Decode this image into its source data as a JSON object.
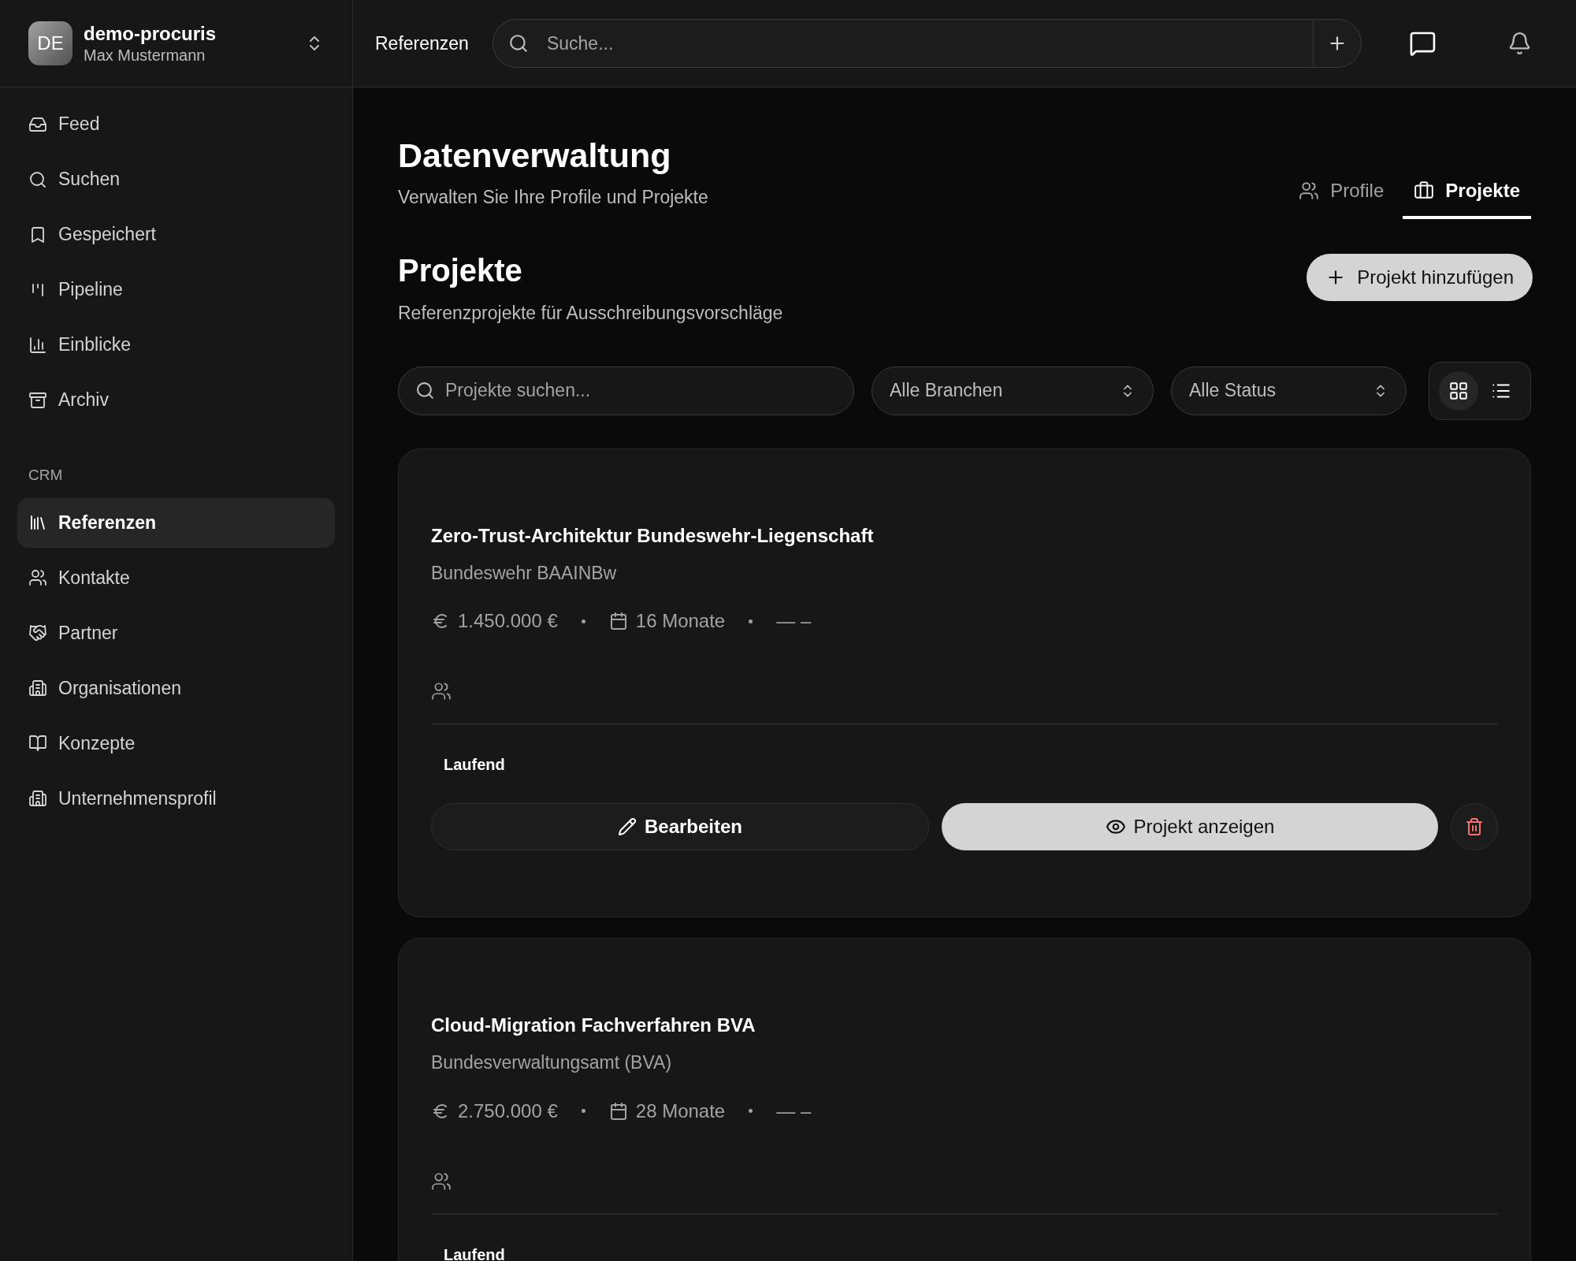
{
  "workspace": {
    "avatar": "DE",
    "name": "demo-procuris",
    "user": "Max Mustermann"
  },
  "sidebar": {
    "items": [
      {
        "label": "Feed",
        "selected": false
      },
      {
        "label": "Suchen",
        "selected": false
      },
      {
        "label": "Gespeichert",
        "selected": false
      },
      {
        "label": "Pipeline",
        "selected": false
      },
      {
        "label": "Einblicke",
        "selected": false
      },
      {
        "label": "Archiv",
        "selected": false
      }
    ],
    "section": {
      "heading": "CRM",
      "items": [
        {
          "label": "Referenzen",
          "selected": true
        },
        {
          "label": "Kontakte",
          "selected": false
        },
        {
          "label": "Partner",
          "selected": false
        },
        {
          "label": "Organisationen",
          "selected": false
        },
        {
          "label": "Konzepte",
          "selected": false
        },
        {
          "label": "Unternehmensprofil",
          "selected": false
        }
      ]
    }
  },
  "header": {
    "title": "Referenzen",
    "search": {
      "placeholder": "Suche..."
    }
  },
  "page": {
    "title": "Datenverwaltung",
    "subtitle": "Verwalten Sie Ihre Profile und Projekte",
    "tabs": [
      {
        "label": "Profile",
        "selected": false
      },
      {
        "label": "Projekte",
        "selected": true
      }
    ]
  },
  "section": {
    "title": "Projekte",
    "subtitle": "Referenzprojekte für Ausschreibungsvorschläge",
    "add_button": "Projekt hinzufügen"
  },
  "filters": {
    "search": {
      "placeholder": "Projekte suchen..."
    },
    "selects": [
      "Alle Branchen",
      "Alle Status"
    ],
    "views": [
      {
        "kind": "grid",
        "selected": true
      },
      {
        "kind": "list",
        "selected": false
      }
    ]
  },
  "projects": [
    {
      "title": "Zero-Trust-Architektur Bundeswehr-Liegenschaft",
      "client": "Bundeswehr BAAINBw",
      "budget": "1.450.000 €",
      "duration": "16 Monate",
      "extra": "— –",
      "status": "Laufend",
      "actions": [
        {
          "kind": "edit",
          "label": "Bearbeiten"
        },
        {
          "kind": "view",
          "label": "Projekt anzeigen"
        },
        {
          "kind": "delete"
        }
      ]
    },
    {
      "title": "Cloud-Migration Fachverfahren BVA",
      "client": "Bundesverwaltungsamt (BVA)",
      "budget": "2.750.000 €",
      "duration": "28 Monate",
      "extra": "— –",
      "status": "Laufend"
    }
  ]
}
